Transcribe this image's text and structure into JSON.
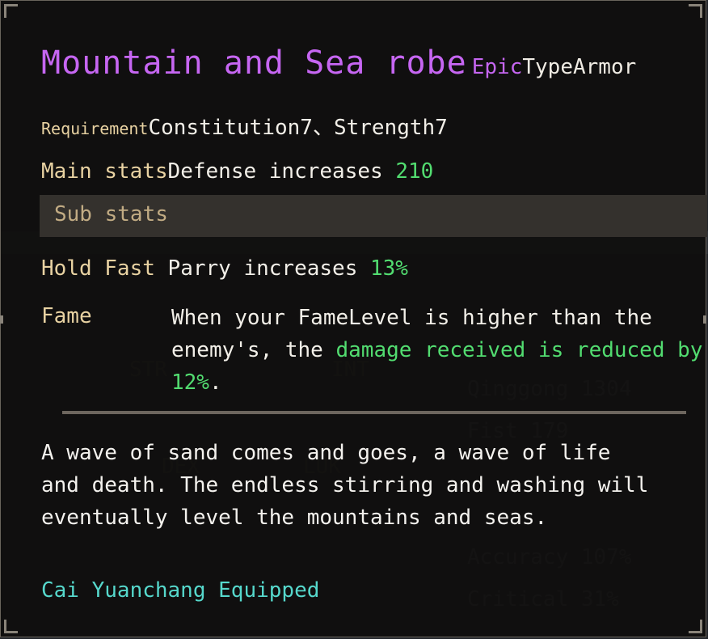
{
  "item": {
    "name": "Mountain and Sea robe",
    "rarity": "Epic",
    "type_label": "Type",
    "type_value": "Armor",
    "rarity_color": "#c666f2"
  },
  "requirement": {
    "label": "Requirement",
    "value": "Constitution7、Strength7"
  },
  "main_stats": {
    "label": "Main stats",
    "text": "Defense increases ",
    "value": "210"
  },
  "sub_stats": {
    "header": "Sub stats",
    "hold_fast": {
      "label": "Hold Fast",
      "text": "Parry increases ",
      "value": "13%"
    }
  },
  "fame": {
    "label": "Fame",
    "text_part1": "When your FameLevel is higher than the enemy's, the ",
    "text_highlight": "damage received is reduced by 12%",
    "text_part2": "."
  },
  "description": "A wave of sand comes and goes, a wave of life and death. The endless stirring and washing will eventually level the mountains and seas.",
  "equipped_by": "Cai Yuanchang Equipped",
  "colors": {
    "highlight_green": "#52dc70",
    "equipped_cyan": "#56d8cc",
    "label_tan": "#e8d2a2"
  }
}
